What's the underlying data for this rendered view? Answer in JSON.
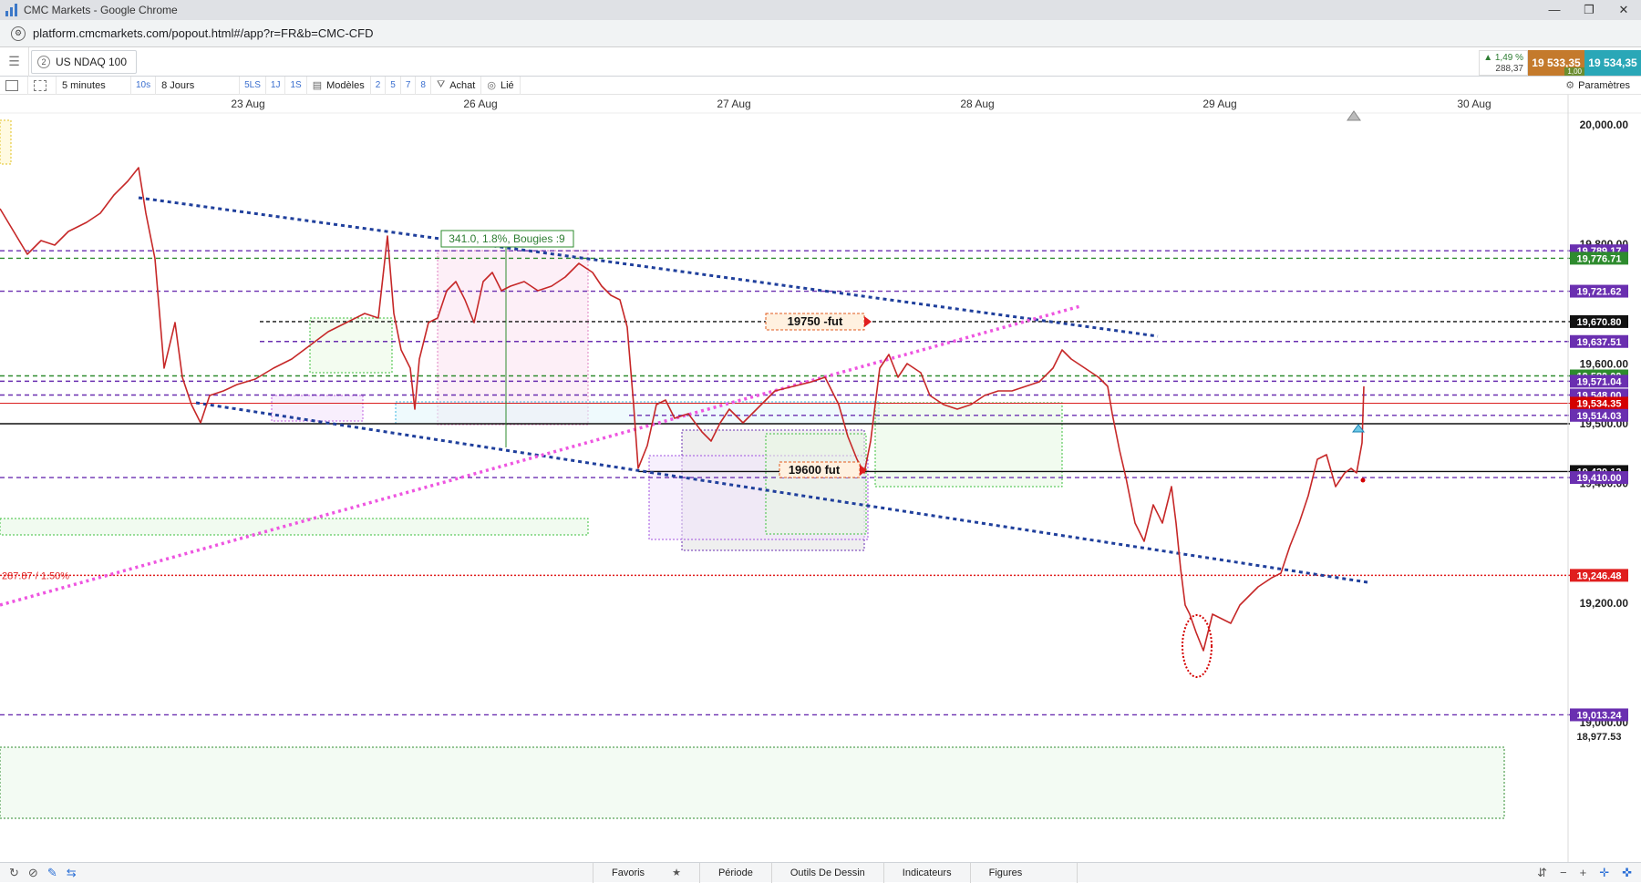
{
  "window": {
    "title": "CMC Markets - Google Chrome",
    "controls": [
      "—",
      "❐",
      "✕"
    ]
  },
  "browser": {
    "url": "platform.cmcmarkets.com/popout.html#/app?r=FR&b=CMC-CFD"
  },
  "header": {
    "tab_number": "2",
    "instrument": "US NDAQ 100",
    "change_pct": "▲ 1,49 %",
    "change_pts": "288,37",
    "sell_price": "19 533,35",
    "buy_price": "19 534,35",
    "spread": "1,00"
  },
  "toolbar": {
    "interval": "5 minutes",
    "interval_short": "10s",
    "range": "8 Jours",
    "quick_ranges": [
      "5LS",
      "1J",
      "1S"
    ],
    "templates_label": "Modèles",
    "layout_counts": [
      "2",
      "5",
      "7",
      "8"
    ],
    "buy_label": "Achat",
    "link_label": "Lié",
    "settings_label": "Paramètres"
  },
  "chart_data": {
    "type": "line",
    "instrument": "US NDAQ 100",
    "x_labels": [
      "23 Aug",
      "26 Aug",
      "27 Aug",
      "28 Aug",
      "29 Aug",
      "30 Aug"
    ],
    "y_ticks": [
      "20,000.00",
      "19,800.00",
      "19,600.00",
      "19,500.00",
      "19,400.00",
      "19,200.00",
      "19,000.00"
    ],
    "ylim": [
      18977.53,
      20060
    ],
    "current_price": "19,534.35",
    "price_labels": [
      {
        "value": 19789.17,
        "text": "19,789.17",
        "color": "#6a2fb0"
      },
      {
        "value": 19776.71,
        "text": "19,776.71",
        "color": "#2e8b2e"
      },
      {
        "value": 19721.62,
        "text": "19,721.62",
        "color": "#6a2fb0"
      },
      {
        "value": 19670.8,
        "text": "19,670.80",
        "color": "#111111"
      },
      {
        "value": 19637.51,
        "text": "19,637.51",
        "color": "#6a2fb0"
      },
      {
        "value": 19580.0,
        "text": "19,580.00",
        "color": "#2e8b2e"
      },
      {
        "value": 19571.04,
        "text": "19,571.04",
        "color": "#6a2fb0"
      },
      {
        "value": 19548.0,
        "text": "19,548.00",
        "color": "#6a2fb0"
      },
      {
        "value": 19534.35,
        "text": "19,534.35",
        "color": "#d40000"
      },
      {
        "value": 19514.03,
        "text": "19,514.03",
        "color": "#6a2fb0"
      },
      {
        "value": 19420.12,
        "text": "19,420.12",
        "color": "#111111"
      },
      {
        "value": 19410.0,
        "text": "19,410.00",
        "color": "#6a2fb0"
      },
      {
        "value": 19246.48,
        "text": "19,246.48",
        "color": "#e01e1e"
      },
      {
        "value": 19013.24,
        "text": "19,013.24",
        "color": "#6a2fb0"
      },
      {
        "value": 18977.53,
        "text": "18,977.53",
        "color": "#444444"
      }
    ],
    "annotations": {
      "measure": "341.0, 1.8%, Bougies :9",
      "fut_19750": "19750 -fut",
      "fut_19600": "19600 fut",
      "pct_line": "287.87 / 1.50%"
    }
  },
  "bottom": {
    "tabs": [
      "Favoris",
      "Période",
      "Outils De Dessin",
      "Indicateurs",
      "Figures"
    ],
    "right_icons": [
      "⇵",
      "−",
      "+",
      "✛",
      "✜"
    ]
  },
  "colors": {
    "sell": "#c47a2c",
    "buy": "#2aa7b7",
    "trend_blue": "#1f3f9c",
    "trend_magenta": "#ee55e0",
    "price_line": "#d40000"
  }
}
